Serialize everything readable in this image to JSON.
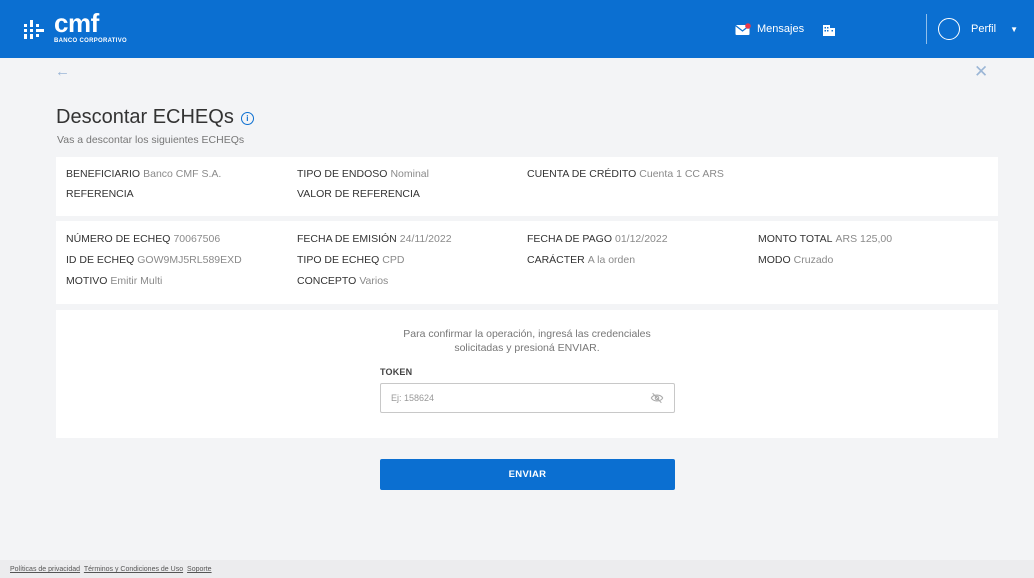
{
  "header": {
    "logo_name": "cmf",
    "logo_subtitle": "BANCO CORPORATIVO",
    "messages_label": "Mensajes",
    "profile_label": "Perfil",
    "brand_color": "#0b6fd1"
  },
  "page": {
    "title": "Descontar ECHEQs",
    "subtitle": "Vas a descontar los siguientes ECHEQs"
  },
  "summary": {
    "beneficiario_label": "BENEFICIARIO",
    "beneficiario_value": "Banco CMF S.A.",
    "tipo_endoso_label": "TIPO DE ENDOSO",
    "tipo_endoso_value": "Nominal",
    "cuenta_credito_label": "CUENTA DE CRÉDITO",
    "cuenta_credito_value": "Cuenta 1 CC ARS",
    "referencia_label": "REFERENCIA",
    "valor_referencia_label": "VALOR DE REFERENCIA"
  },
  "echeq": {
    "numero_label": "NÚMERO DE ECHEQ",
    "numero_value": "70067506",
    "fecha_emision_label": "FECHA DE EMISIÓN",
    "fecha_emision_value": "24/11/2022",
    "fecha_pago_label": "FECHA DE PAGO",
    "fecha_pago_value": "01/12/2022",
    "monto_label": "MONTO TOTAL",
    "monto_value": "ARS 125,00",
    "id_label": "ID DE ECHEQ",
    "id_value": "GOW9MJ5RL589EXD",
    "tipo_label": "TIPO DE ECHEQ",
    "tipo_value": "CPD",
    "caracter_label": "CARÁCTER",
    "caracter_value": "A la orden",
    "modo_label": "MODO",
    "modo_value": "Cruzado",
    "motivo_label": "MOTIVO",
    "motivo_value": "Emitir Multi",
    "concepto_label": "CONCEPTO",
    "concepto_value": "Varios"
  },
  "confirm": {
    "text_line1": "Para confirmar la operación, ingresá las credenciales",
    "text_line2": "solicitadas y presioná ENVIAR.",
    "token_label": "TOKEN",
    "token_placeholder": "Ej: 158624",
    "token_value": "",
    "submit_label": "ENVIAR"
  },
  "footer": {
    "privacy": "Políticas de privacidad",
    "terms": "Términos y Condiciones de Uso",
    "support": "Soporte"
  },
  "icons": [
    "logo-icon",
    "mail-icon",
    "building-icon",
    "avatar-icon",
    "chevron-down-icon",
    "back-arrow-icon",
    "close-icon",
    "info-icon",
    "eye-off-icon"
  ]
}
